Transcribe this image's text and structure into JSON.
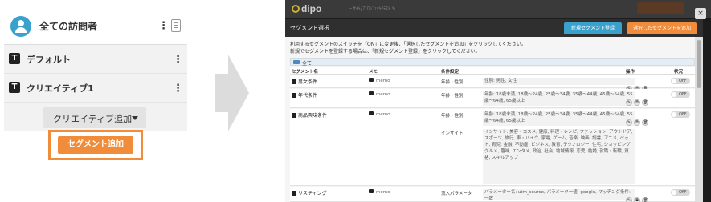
{
  "left_panel": {
    "visitor_label": "全ての訪問者",
    "segments": [
      "デフォルト",
      "クリエイティブ1"
    ],
    "creative_add_label": "クリエイティブ追加",
    "segment_add_label": "セグメント追加",
    "badge_letter": "T",
    "kebab": "⋮"
  },
  "right_window": {
    "logo": "dipo",
    "topbar_text": "ｰ ｻｲﾄ/ﾌﾟﾛｼﾞｪｸﾄ/ﾃｽﾄ ✎",
    "close": "×",
    "modal_title": "セグメント選択",
    "new_segment_button": "新規セグメント登録",
    "add_selected_button": "選択したセグメントを追加",
    "instructions": [
      "利用するセグメントのスイッチを「ON」に変更後、「選択したセグメントを追加」をクリックしてください。",
      "新規でセグメントを登録する場合は、「新規セグメント登録」をクリックしてください。"
    ],
    "folder_label": "全て",
    "table_headers": [
      "セグメント名",
      "メモ",
      "条件設定",
      "",
      "操作",
      "状況"
    ],
    "rows": [
      {
        "name": "男女条件",
        "memo": "memo",
        "conditions": [
          {
            "key": "年齢・性別",
            "value": "性別: 男性, 女性"
          }
        ],
        "toggle": "OFF"
      },
      {
        "name": "年代条件",
        "memo": "memo",
        "conditions": [
          {
            "key": "年齢・性別",
            "value": "年齢: 18歳未満, 18歳〜24歳, 25歳〜34歳, 35歳〜44歳, 45歳〜54歳, 55歳〜64歳, 65歳以上"
          }
        ],
        "toggle": "OFF"
      },
      {
        "name": "商品興味条件",
        "memo": "memo",
        "conditions": [
          {
            "key": "年齢・性別",
            "value": "年齢: 18歳未満, 18歳〜24歳, 25歳〜34歳, 35歳〜44歳, 45歳〜54歳, 55歳〜64歳, 65歳以上"
          },
          {
            "key": "インサイト",
            "value": "インサイト: 美容・コスメ, 健康, 料理・レシピ, ファッション, アウトドア, スポーツ, 旅行, 車・バイク, 家電, ゲーム, 音楽, 映画, 読書, アニメ, ペット, 育児, 金融, 不動産, ビジネス, 教育, テクノロジー, 住宅, ショッピング, グルメ, 趣味, エンタメ, 政治, 社会, 地域情報, 恋愛, 結婚, 就職・転職, 資格, スキルアップ"
          }
        ],
        "toggle": "OFF"
      },
      {
        "name": "リスティング",
        "memo": "memo",
        "conditions": [
          {
            "key": "流入パラメータ",
            "value": "パラメーター名: utm_source, パラメーター値: google, マッチング条件: 一致"
          }
        ],
        "toggle": "OFF"
      }
    ]
  },
  "colors": {
    "accent_blue": "#3aa0cc",
    "accent_orange": "#f08c3a"
  }
}
